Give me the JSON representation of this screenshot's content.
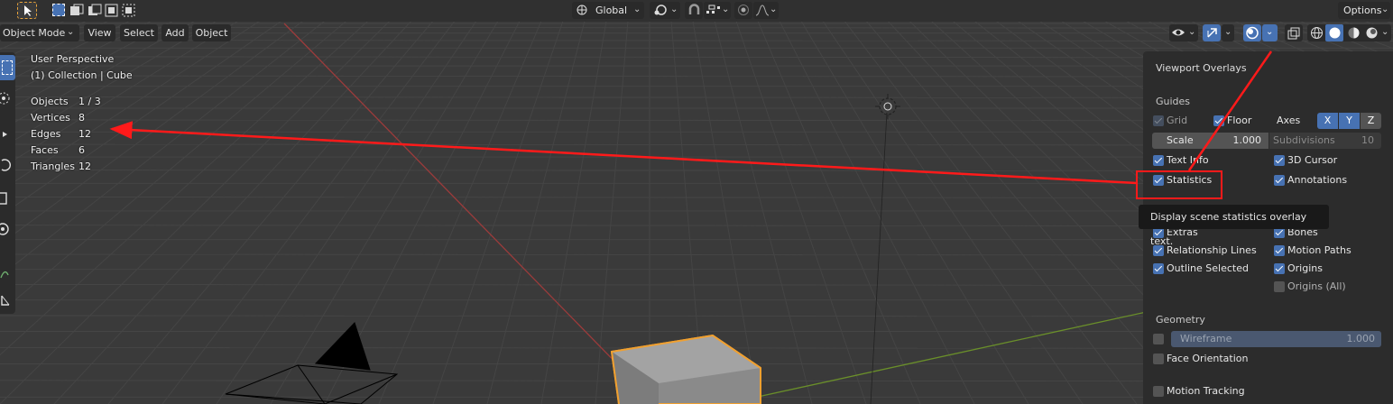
{
  "header": {
    "transform_orientation": "Global",
    "options_label": "Options"
  },
  "viewport_header": {
    "mode": "Object Mode",
    "menus": [
      "View",
      "Select",
      "Add",
      "Object"
    ]
  },
  "overlay_text": {
    "perspective": "User Perspective",
    "collection": "(1) Collection | Cube",
    "stats": [
      {
        "label": "Objects",
        "value": "1 / 3"
      },
      {
        "label": "Vertices",
        "value": "8"
      },
      {
        "label": "Edges",
        "value": "12"
      },
      {
        "label": "Faces",
        "value": "6"
      },
      {
        "label": "Triangles",
        "value": "12"
      }
    ]
  },
  "overlays_panel": {
    "title": "Viewport Overlays",
    "guides_heading": "Guides",
    "grid_label": "Grid",
    "floor_label": "Floor",
    "axes_label": "Axes",
    "axes": [
      "X",
      "Y",
      "Z"
    ],
    "scale_label": "Scale",
    "scale_value": "1.000",
    "subdivisions_label": "Subdivisions",
    "subdivisions_value": "10",
    "text_info_label": "Text Info",
    "cursor_label": "3D Cursor",
    "statistics_label": "Statistics",
    "annotations_label": "Annotations",
    "extras_label": "Extras",
    "bones_label": "Bones",
    "relationship_label": "Relationship Lines",
    "motion_paths_label": "Motion Paths",
    "outline_label": "Outline Selected",
    "origins_label": "Origins",
    "origins_all_label": "Origins (All)",
    "geometry_heading": "Geometry",
    "wireframe_label": "Wireframe",
    "wireframe_value": "1.000",
    "face_orientation_label": "Face Orientation",
    "motion_tracking_label": "Motion Tracking"
  },
  "tooltip": "Display scene statistics overlay text.",
  "colors": {
    "accent": "#4772b3",
    "annotation": "#ff1a1a",
    "x_axis": "#9c3b3b",
    "y_axis": "#6a8f2a",
    "selection_outline": "#f0a030"
  }
}
